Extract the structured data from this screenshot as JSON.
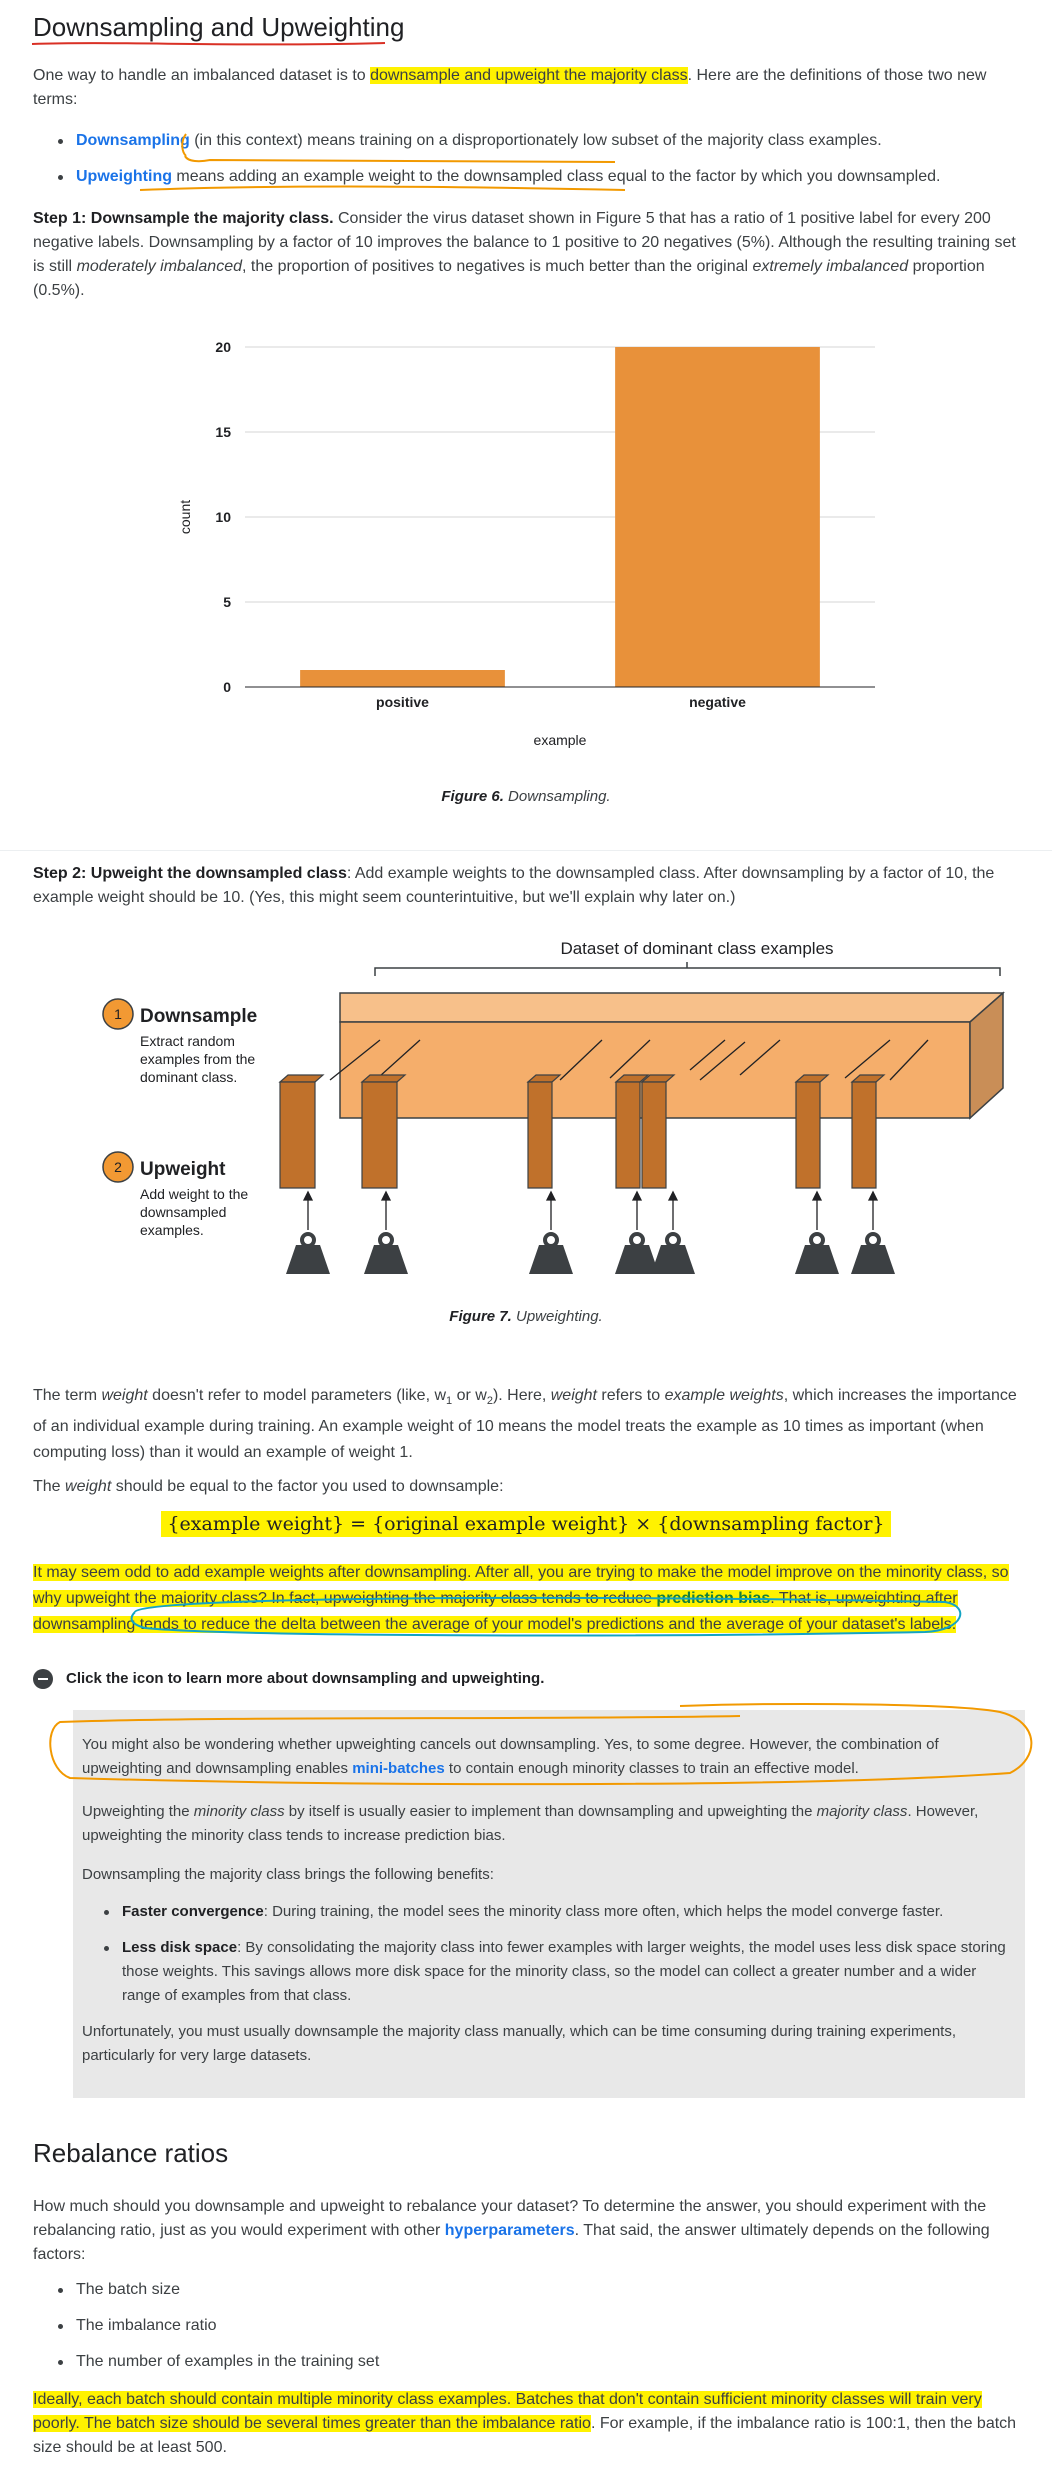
{
  "section1": {
    "heading": "Downsampling and Upweighting",
    "intro_a": "One way to handle an imbalanced dataset is to ",
    "intro_hl": "downsample and upweight the majority class",
    "intro_b": ". Here are the definitions of those two new terms:",
    "bullet1_term": "Downsampling",
    "bullet1_text": " (in this context) means training on a disproportionately low subset of the majority class examples.",
    "bullet2_term": "Upweighting",
    "bullet2_text": " means adding an example weight to the downsampled class equal to the factor by which you downsampled.",
    "step1_title": "Step 1: Downsample the majority class.",
    "step1_a": " Consider the virus dataset shown in Figure 5 that has a ratio of 1 positive label for every 200 negative labels. Downsampling by a factor of 10 improves the balance to 1 positive to 20 negatives (5%). Although the resulting training set is still ",
    "step1_em1": "moderately imbalanced",
    "step1_b": ", the proportion of positives to negatives is much better than the original ",
    "step1_em2": "extremely imbalanced",
    "step1_c": " proportion (0.5%)."
  },
  "chart_data": {
    "type": "bar",
    "categories": [
      "positive",
      "negative"
    ],
    "values": [
      1,
      20
    ],
    "xlabel": "example",
    "ylabel": "count",
    "ylim": [
      0,
      20
    ],
    "yticks": [
      0,
      5,
      10,
      15,
      20
    ],
    "grid": true,
    "bar_color": "#e8913a"
  },
  "fig6": {
    "label": "Figure 6.",
    "caption": " Downsampling."
  },
  "step2": {
    "title": "Step 2: Upweight the downsampled class",
    "text": ": Add example weights to the downsampled class. After downsampling by a factor of 10, the example weight should be 10. (Yes, this might seem counterintuitive, but we'll explain why later on.)"
  },
  "fig7": {
    "dataset_label": "Dataset of dominant class examples",
    "step1_num": "1",
    "step1_title": "Downsample",
    "step1_desc": [
      "Extract random",
      "examples from the",
      "dominant class."
    ],
    "step2_num": "2",
    "step2_title": "Upweight",
    "step2_desc": [
      "Add weight to the",
      "downsampled",
      "examples."
    ],
    "label": "Figure 7.",
    "caption": " Upweighting."
  },
  "weight_para": {
    "a": "The term ",
    "em1": "weight",
    "b": " doesn't refer to model parameters (like, w",
    "sub1": "1",
    "c": " or w",
    "sub2": "2",
    "d": "). Here, ",
    "em2": "weight",
    "e": " refers to ",
    "em3": "example weights",
    "f": ", which increases the importance of an individual example during training. An example weight of 10 means the model treats the example as 10 times as important (when computing loss) than it would an example of weight 1."
  },
  "equal_para": {
    "a": "The ",
    "em": "weight",
    "b": " should be equal to the factor you used to downsample:"
  },
  "formula": "{example weight} = {original example weight} × {downsampling factor}",
  "odd_para": {
    "a": "It may seem odd to add example weights after downsampling. After all, you are trying to make the model improve on the minority class, so why upweight the majority class? In fact, upweighting the majority class tends to reduce ",
    "link": "prediction bias",
    "b": ". That is, upweighting after downsampling tends to reduce the delta between the average of your model's predictions and the average of your dataset's labels."
  },
  "expand": {
    "label": "Click the icon to learn more about downsampling and upweighting.",
    "p1_a": "You might also be wondering whether upweighting cancels out downsampling. Yes, to some degree. However, the combination of upweighting and downsampling enables ",
    "p1_link": "mini-batches",
    "p1_b": " to contain enough minority classes to train an effective model.",
    "p2_a": "Upweighting the ",
    "p2_em1": "minority class",
    "p2_b": " by itself is usually easier to implement than downsampling and upweighting the ",
    "p2_em2": "majority class",
    "p2_c": ". However, upweighting the minority class tends to increase prediction bias.",
    "p3": "Downsampling the majority class brings the following benefits:",
    "b1_term": "Faster convergence",
    "b1_text": ": During training, the model sees the minority class more often, which helps the model converge faster.",
    "b2_term": "Less disk space",
    "b2_text": ": By consolidating the majority class into fewer examples with larger weights, the model uses less disk space storing those weights. This savings allows more disk space for the minority class, so the model can collect a greater number and a wider range of examples from that class.",
    "p4": "Unfortunately, you must usually downsample the majority class manually, which can be time consuming during training experiments, particularly for very large datasets."
  },
  "section2": {
    "heading": "Rebalance ratios",
    "p1_a": "How much should you downsample and upweight to rebalance your dataset? To determine the answer, you should experiment with the rebalancing ratio, just as you would experiment with other ",
    "p1_link": "hyperparameters",
    "p1_b": ". That said, the answer ultimately depends on the following factors:",
    "factors": [
      "The batch size",
      "The imbalance ratio",
      "The number of examples in the training set"
    ],
    "p2_hl": "Ideally, each batch should contain multiple minority class examples. Batches that don't contain sufficient minority classes will train very poorly. The batch size should be several times greater than the imbalance ratio",
    "p2_b": ". For example, if the imbalance ratio is 100:1, then the batch size should be at least 500."
  }
}
